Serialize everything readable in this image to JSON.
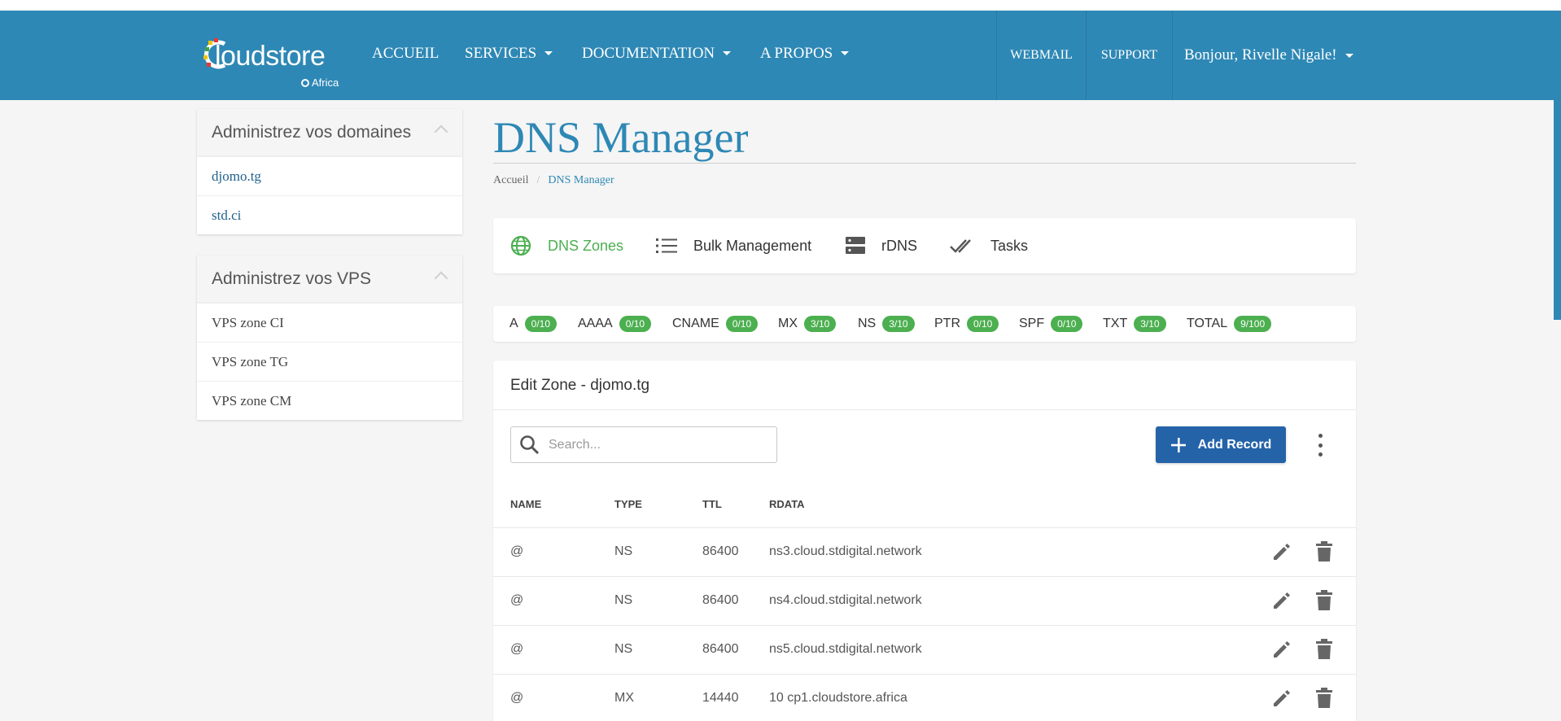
{
  "header": {
    "logo_text": "loudstore",
    "logo_sub": "Africa",
    "nav": [
      {
        "label": "ACCUEIL",
        "dropdown": false
      },
      {
        "label": "SERVICES",
        "dropdown": true
      },
      {
        "label": "DOCUMENTATION",
        "dropdown": true
      },
      {
        "label": "A PROPOS",
        "dropdown": true
      }
    ],
    "webmail": "WEBMAIL",
    "support": "SUPPORT",
    "user_greeting": "Bonjour, Rivelle Nigale!",
    "color": "#2e88b5"
  },
  "sidebar": {
    "domains": {
      "title": "Administrez vos domaines",
      "items": [
        "djomo.tg",
        "std.ci"
      ]
    },
    "vps": {
      "title": "Administrez vos VPS",
      "items": [
        "VPS zone CI",
        "VPS zone TG",
        "VPS zone CM"
      ]
    }
  },
  "page": {
    "title": "DNS Manager",
    "breadcrumb": {
      "home": "Accueil",
      "current": "DNS Manager"
    }
  },
  "tabs": [
    {
      "label": "DNS Zones",
      "icon": "globe-icon",
      "active": true
    },
    {
      "label": "Bulk Management",
      "icon": "list-icon",
      "active": false
    },
    {
      "label": "rDNS",
      "icon": "server-icon",
      "active": false
    },
    {
      "label": "Tasks",
      "icon": "double-check-icon",
      "active": false
    }
  ],
  "record_counts": [
    {
      "type": "A",
      "count": "0/10"
    },
    {
      "type": "AAAA",
      "count": "0/10"
    },
    {
      "type": "CNAME",
      "count": "0/10"
    },
    {
      "type": "MX",
      "count": "3/10"
    },
    {
      "type": "NS",
      "count": "3/10"
    },
    {
      "type": "PTR",
      "count": "0/10"
    },
    {
      "type": "SPF",
      "count": "0/10"
    },
    {
      "type": "TXT",
      "count": "3/10"
    },
    {
      "type": "TOTAL",
      "count": "9/100"
    }
  ],
  "zone": {
    "title": "Edit Zone - djomo.tg",
    "search_placeholder": "Search...",
    "add_button": "Add Record",
    "columns": [
      "NAME",
      "TYPE",
      "TTL",
      "RDATA"
    ],
    "rows": [
      {
        "name": "@",
        "type": "NS",
        "ttl": "86400",
        "rdata": "ns3.cloud.stdigital.network"
      },
      {
        "name": "@",
        "type": "NS",
        "ttl": "86400",
        "rdata": "ns4.cloud.stdigital.network"
      },
      {
        "name": "@",
        "type": "NS",
        "ttl": "86400",
        "rdata": "ns5.cloud.stdigital.network"
      },
      {
        "name": "@",
        "type": "MX",
        "ttl": "14440",
        "rdata": "10 cp1.cloudstore.africa"
      }
    ]
  },
  "colors": {
    "accent_green": "#4caf50",
    "button_blue": "#2563a9",
    "link_blue": "#21628a"
  }
}
